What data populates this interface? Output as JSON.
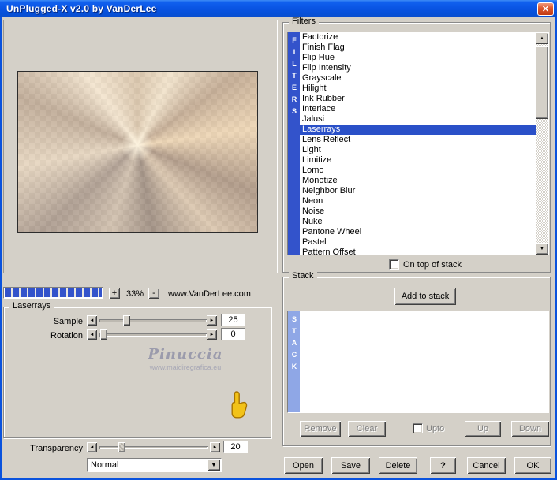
{
  "window": {
    "title": "UnPlugged-X v2.0 by VanDerLee"
  },
  "icons": {
    "close": "✕",
    "arrow_left": "◄",
    "arrow_right": "►",
    "arrow_up": "▲",
    "arrow_down": "▼",
    "dropdown": "▼"
  },
  "preview": {
    "zoom_in": "+",
    "zoom_out": "-",
    "zoom_value": "33%",
    "website": "www.VanDerLee.com"
  },
  "laserrays": {
    "group_title": "Laserrays",
    "sample_label": "Sample",
    "sample_value": "25",
    "rotation_label": "Rotation",
    "rotation_value": "0",
    "transparency_label": "Transparency",
    "transparency_value": "20",
    "blend_mode": "Normal",
    "watermark_name": "Pinuccia",
    "watermark_url": "www.maidiregrafica.eu"
  },
  "filters": {
    "group_title": "Filters",
    "vertical_label": "FILTERS",
    "selected": "Laserrays",
    "on_top_label": "On top of stack",
    "items": [
      "Factorize",
      "Finish Flag",
      "Flip Hue",
      "Flip Intensity",
      "Grayscale",
      "Hilight",
      "Ink Rubber",
      "Interlace",
      "Jalusi",
      "Laserrays",
      "Lens Reflect",
      "Light",
      "Limitize",
      "Lomo",
      "Monotize",
      "Neighbor Blur",
      "Neon",
      "Noise",
      "Nuke",
      "Pantone Wheel",
      "Pastel",
      "Pattern Offset"
    ]
  },
  "stack": {
    "group_title": "Stack",
    "vertical_label": "STACK",
    "add_button": "Add to stack",
    "remove_button": "Remove",
    "clear_button": "Clear",
    "upto_label": "Upto",
    "up_button": "Up",
    "down_button": "Down"
  },
  "footer": {
    "open": "Open",
    "save": "Save",
    "delete": "Delete",
    "help": "?",
    "cancel": "Cancel",
    "ok": "OK"
  }
}
